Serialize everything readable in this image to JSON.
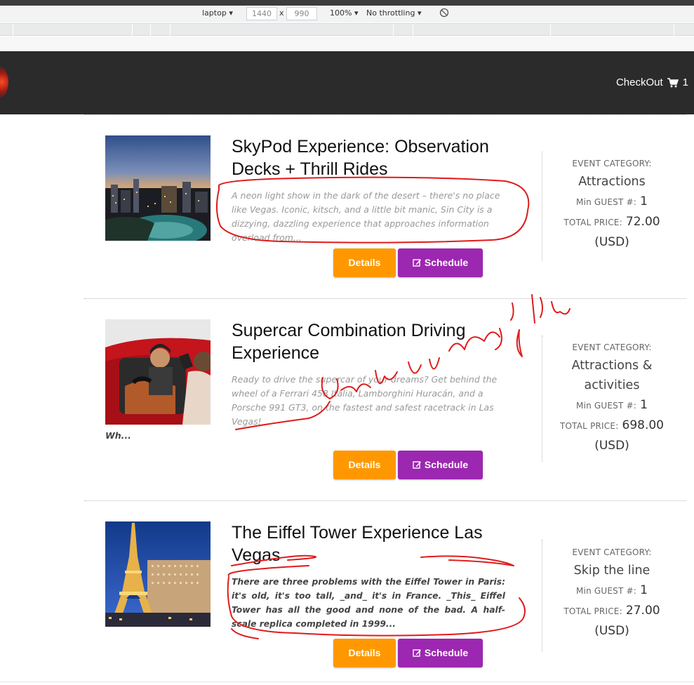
{
  "devtools": {
    "device": "laptop",
    "width": "1440",
    "times": "x",
    "height": "990",
    "zoom": "100%",
    "throttling": "No throttling"
  },
  "header": {
    "checkout_label": "CheckOut",
    "cart_count": "1"
  },
  "labels": {
    "event_category": "EVENT CATEGORY:",
    "min_guest": "Min GUEST #:",
    "total_price": "TOTAL PRICE:",
    "currency": "(USD)",
    "details": "Details",
    "schedule": "Schedule"
  },
  "listings": [
    {
      "title": "SkyPod Experience: Observation Decks + Thrill Rides",
      "description": "A neon light show in the dark of the desert – there's no place like Vegas. Iconic, kitsch, and a little bit manic, Sin City is a dizzying, dazzling experience that approaches information overload from...",
      "category": "Attractions",
      "min_guest": "1",
      "total_price": "72.00"
    },
    {
      "title": "Supercar Combination Driving Experience",
      "description": "Ready to drive the supercar of your dreams? Get behind the wheel of a Ferrari 458 Italia, Lamborghini Huracán, and a Porsche 991 GT3, on the fastest and safest racetrack in Las Vegas!",
      "more": "Wh...",
      "category": "Attractions & activities",
      "min_guest": "1",
      "total_price": "698.00"
    },
    {
      "title": "The Eiffel Tower Experience Las Vegas",
      "description": "There are three problems with the Eiffel Tower in Paris: it's old, it's too tall, _and_ it's in France. _This_ Eiffel Tower has all the good and none of the bad. A half-scale replica completed in 1999...",
      "category": "Skip the line",
      "min_guest": "1",
      "total_price": "27.00"
    }
  ],
  "colors": {
    "header_bg": "#2b2b2b",
    "details_button": "#ff9800",
    "schedule_button": "#9c27b0",
    "annotation_ink": "#e01b1b"
  }
}
